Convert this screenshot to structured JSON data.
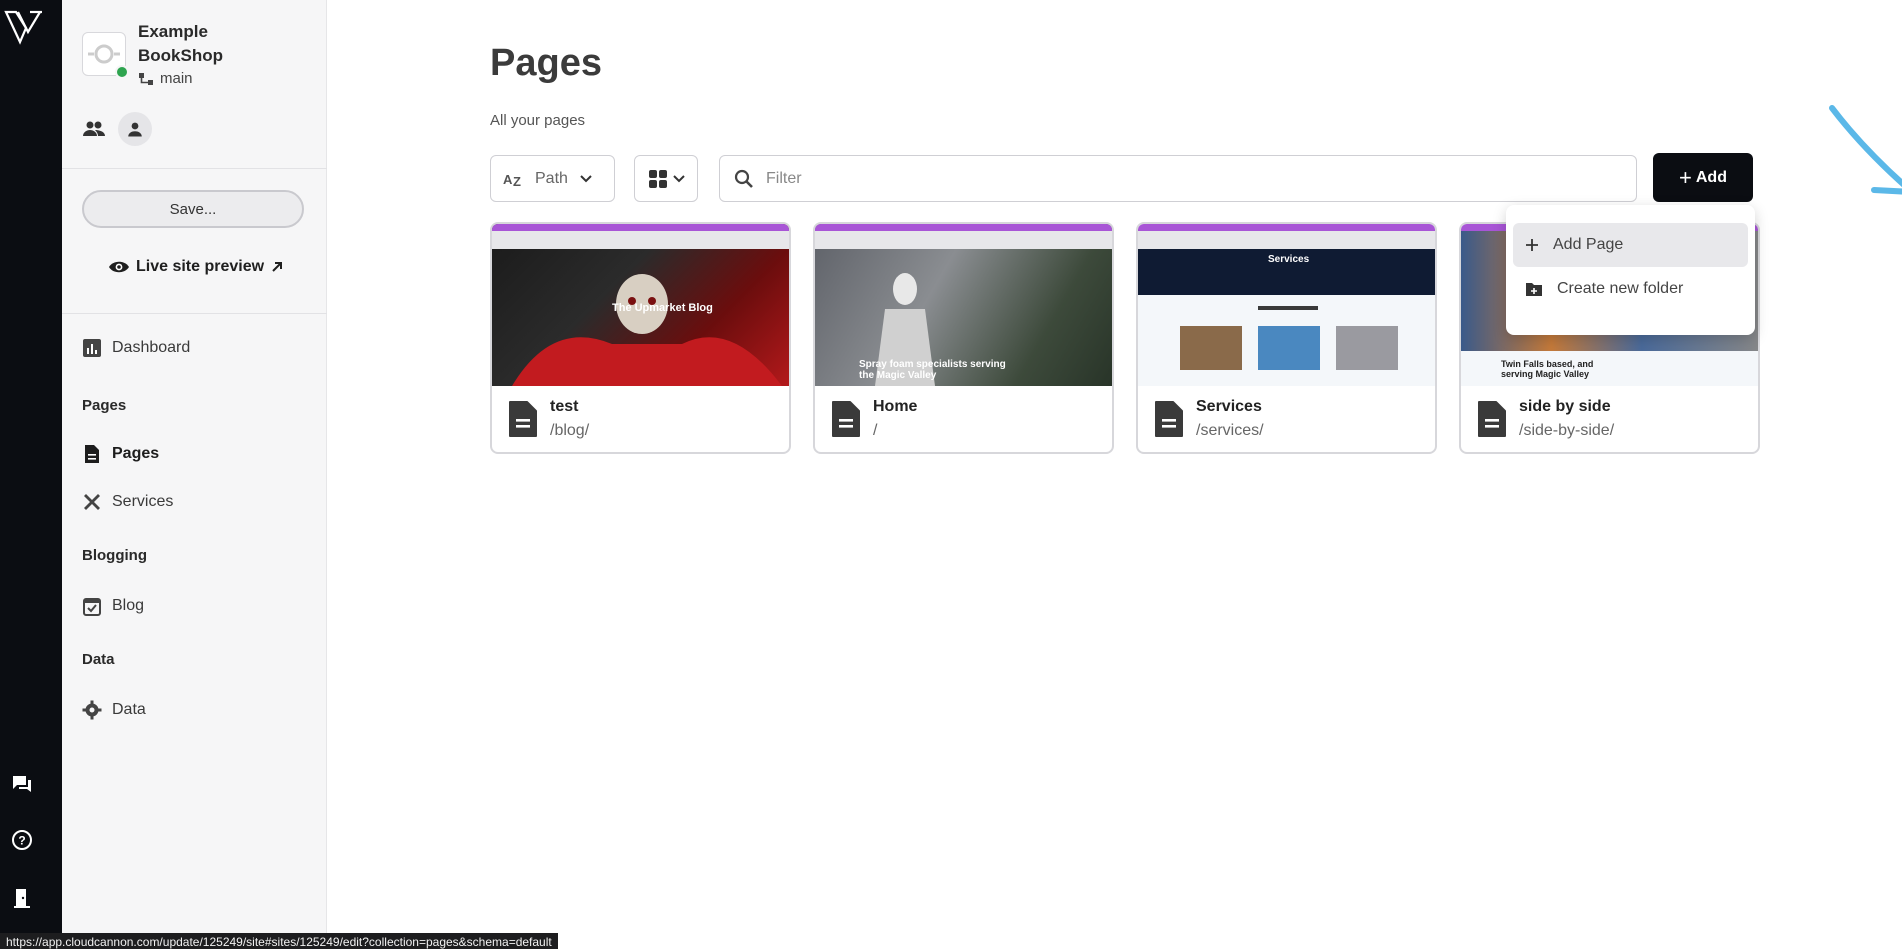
{
  "site": {
    "name": "Example BookShop",
    "branch": "main"
  },
  "sidebar": {
    "save_label": "Save...",
    "preview_label": "Live site preview",
    "dashboard_label": "Dashboard",
    "sections": {
      "pages_heading": "Pages",
      "blogging_heading": "Blogging",
      "data_heading": "Data"
    },
    "items": {
      "pages": "Pages",
      "services": "Services",
      "blog": "Blog",
      "data": "Data"
    }
  },
  "main": {
    "title": "Pages",
    "subtitle": "All your pages",
    "sort_label": "Path",
    "filter_placeholder": "Filter",
    "add_label": "Add"
  },
  "dropdown": {
    "items": [
      "Add Page",
      "Create new folder"
    ]
  },
  "cards": [
    {
      "title": "test",
      "path": "/blog/",
      "thumb_caption": "The Upmarket Blog"
    },
    {
      "title": "Home",
      "path": "/",
      "thumb_caption": "Spray foam specialists serving the Magic Valley"
    },
    {
      "title": "Services",
      "path": "/services/",
      "thumb_caption": "Services"
    },
    {
      "title": "side by side",
      "path": "/side-by-side/",
      "thumb_caption": "Twin Falls based, and serving Magic Valley"
    }
  ],
  "status_url": "https://app.cloudcannon.com/update/125249/site#sites/125249/edit?collection=pages&schema=default",
  "colors": {
    "accent": "#0b0d12",
    "thumb_bar": "#a855d6",
    "annotation": "#5bb8e8",
    "ok": "#2ea44f"
  }
}
